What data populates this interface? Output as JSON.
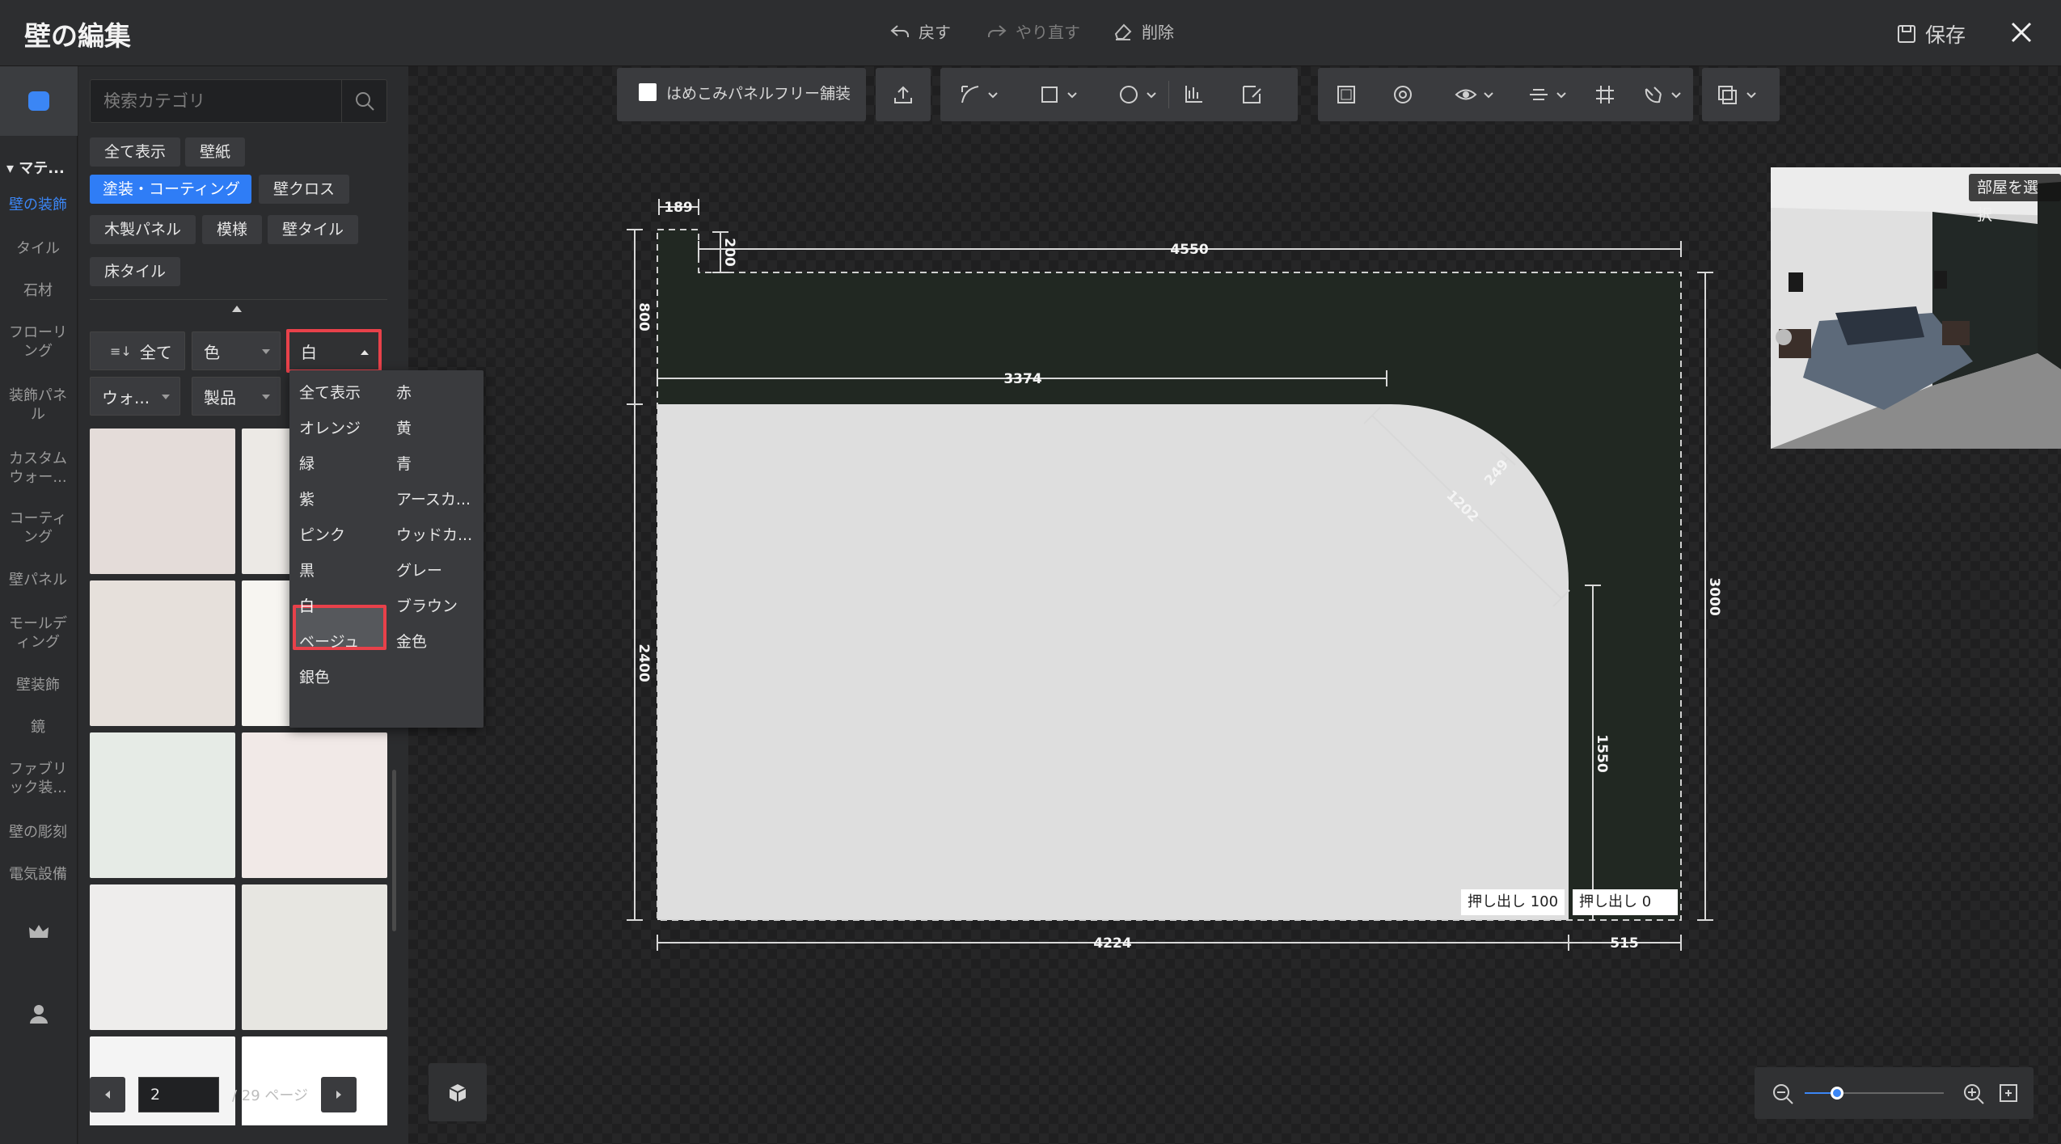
{
  "header": {
    "title": "壁の編集",
    "undo_label": "戻す",
    "redo_label": "やり直す",
    "delete_label": "削除",
    "save_label": "保存"
  },
  "rail": {
    "section_label": "▾ マテ...",
    "items": [
      {
        "label": "壁の装飾",
        "active": true
      },
      {
        "label": "タイル"
      },
      {
        "label": "石材"
      },
      {
        "label": "フローリング"
      },
      {
        "label": "装飾パネル"
      },
      {
        "label": "カスタムウォー..."
      },
      {
        "label": "コーティング"
      },
      {
        "label": "壁パネル"
      },
      {
        "label": "モールディング"
      },
      {
        "label": "壁装飾"
      },
      {
        "label": "鏡"
      },
      {
        "label": "ファブリック装..."
      },
      {
        "label": "壁の彫刻"
      },
      {
        "label": "電気設備"
      }
    ]
  },
  "panel": {
    "search_placeholder": "検索カテゴリ",
    "categories": [
      "全て表示",
      "壁紙",
      "塗装・コーティング",
      "壁クロス",
      "木製パネル",
      "模様",
      "壁タイル",
      "床タイル"
    ],
    "selected_category": "塗装・コーティング",
    "filters": {
      "sort_label": "全て",
      "color_label": "色",
      "color_value": "白",
      "style_label": "ウォ...",
      "product_label": "製品"
    },
    "swatch_colors": [
      "#e4dcd9",
      "#ece9e5",
      "#e6e0db",
      "#f7f5f1",
      "#e6ebe6",
      "#f1e9e7",
      "#eeedec",
      "#e7e6e1",
      "#f4f4f4",
      "#ffffff"
    ],
    "page_current": "2",
    "page_total_label": "/ 29 ページ"
  },
  "color_menu": {
    "items": [
      "全て表示",
      "赤",
      "オレンジ",
      "黄",
      "緑",
      "青",
      "紫",
      "アースカ...",
      "ピンク",
      "ウッドカ...",
      "黒",
      "グレー",
      "白",
      "ブラウン",
      "ベージュ",
      "金色",
      "銀色"
    ],
    "selected": "白"
  },
  "toolbar": {
    "paver_label": "はめこみパネルフリー舗装"
  },
  "drawing": {
    "wall_color": "#212822",
    "panel_color": "#dedede",
    "dimensions": [
      "189",
      "200",
      "4550",
      "800",
      "3374",
      "249",
      "1202",
      "3000",
      "2400",
      "1550",
      "4224",
      "515"
    ],
    "extrude_left": "押し出し  100",
    "extrude_right": "押し出し  0"
  },
  "preview": {
    "select_room_label": "部屋を選択"
  },
  "zoom": {
    "level": 0.23
  }
}
